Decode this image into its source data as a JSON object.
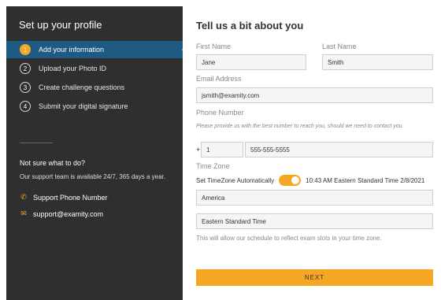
{
  "sidebar": {
    "title": "Set up your profile",
    "steps": [
      {
        "num": "1",
        "label": "Add your information"
      },
      {
        "num": "2",
        "label": "Upload your Photo ID"
      },
      {
        "num": "3",
        "label": "Create challenge questions"
      },
      {
        "num": "4",
        "label": "Submit your digital signature"
      }
    ],
    "help_title": "Not sure what to do?",
    "help_text": "Our support team is available 24/7, 365 days a year.",
    "phone_link": "Support Phone Number",
    "email_link": "support@examity.com",
    "accent_color": "#f5a623",
    "active_color": "#1f5a82"
  },
  "form": {
    "title": "Tell us a bit about you",
    "first_name_label": "First Name",
    "first_name_value": "Jane",
    "last_name_label": "Last Name",
    "last_name_value": "Smith",
    "email_label": "Email Address",
    "email_value": "jsmith@examity.com",
    "phone_label": "Phone Number",
    "phone_hint": "Please provide us with the best number to reach you, should we need to contact you.",
    "country_code_prefix": "+",
    "country_code_value": "1",
    "phone_value": "555-555-5555",
    "timezone_label": "Time Zone",
    "auto_timezone_label": "Set TimeZone Automatically",
    "auto_timezone_on": true,
    "current_time": "10:43 AM Eastern Standard Time 2/8/2021",
    "region_value": "America",
    "timezone_value": "Eastern Standard Time",
    "timezone_note": "This will allow our schedule to reflect exam slots in your time zone.",
    "next_label": "NEXT"
  }
}
